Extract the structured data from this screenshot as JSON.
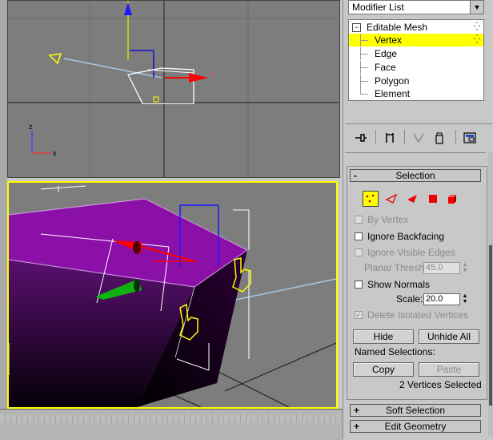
{
  "panel": {
    "modifier_list": "Modifier List",
    "stack": {
      "root": "Editable Mesh",
      "items": [
        "Vertex",
        "Edge",
        "Face",
        "Polygon",
        "Element"
      ],
      "selected": "Vertex"
    },
    "toolbar_icons": [
      "pin-stack-icon",
      "show-end-result-icon",
      "make-unique-icon",
      "remove-modifier-icon",
      "configure-modifier-sets-icon"
    ]
  },
  "selection": {
    "title": "Selection",
    "sub_objects": [
      "vertex-icon",
      "edge-icon",
      "face-icon",
      "polygon-icon",
      "element-icon"
    ],
    "by_vertex": "By Vertex",
    "ignore_backfacing": "Ignore Backfacing",
    "ignore_visible_edges": "Ignore Visible Edges",
    "planar_thresh_label": "Planar Thresh:",
    "planar_thresh_value": "45.0",
    "show_normals": "Show Normals",
    "scale_label": "Scale:",
    "scale_value": "20.0",
    "delete_isolated": "Delete Isolated Vertices",
    "hide": "Hide",
    "unhide_all": "Unhide All",
    "named_selections": "Named Selections:",
    "copy": "Copy",
    "paste": "Paste",
    "status": "2 Vertices Selected"
  },
  "rollouts": {
    "soft_selection": "Soft Selection",
    "edit_geometry": "Edit Geometry"
  },
  "viewport_top": {
    "axis_x": "x",
    "axis_z": "z",
    "axis_gizmo_x": "x"
  },
  "colors": {
    "highlight": "#ffff00",
    "mesh_top": "#8b10a8",
    "viewport_bg": "#7d7d7d"
  }
}
